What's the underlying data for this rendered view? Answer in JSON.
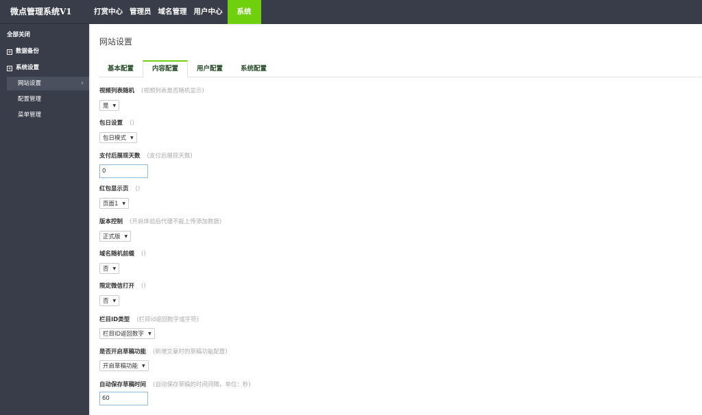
{
  "app": {
    "title": "微点管理系统V1"
  },
  "topnav": {
    "items": [
      "打赏中心",
      "管理员",
      "域名管理",
      "用户中心",
      "系统"
    ]
  },
  "sidebar": {
    "collapse_all": "全部关闭",
    "groups": [
      {
        "label": "数据备份"
      },
      {
        "label": "系统设置"
      }
    ],
    "sub_items": [
      {
        "label": "网站设置"
      },
      {
        "label": "配置管理"
      },
      {
        "label": "菜单管理"
      }
    ]
  },
  "main": {
    "title": "网站设置",
    "tabs": [
      "基本配置",
      "内容配置",
      "用户配置",
      "系统配置"
    ],
    "active_tab": "内容配置",
    "fields": [
      {
        "label": "视频列表随机",
        "hint": "(视频列表是否随机显示)",
        "value": "是"
      },
      {
        "label": "包日设置",
        "hint": "()",
        "value": "包日模式"
      },
      {
        "label": "支付后展现天数",
        "hint": "(支付后展现天数)",
        "value": "0"
      },
      {
        "label": "红包显示页",
        "hint": "()",
        "value": "页面1"
      },
      {
        "label": "版本控制",
        "hint": "(开启体验后代理不能上传添加数据)",
        "value": "正式版"
      },
      {
        "label": "域名随机前缀",
        "hint": "()",
        "value": "否"
      },
      {
        "label": "限定微信打开",
        "hint": "()",
        "value": "否"
      },
      {
        "label": "栏目ID类型",
        "hint": "(栏目id返回数字或字符)",
        "value": "栏目ID返回数字"
      },
      {
        "label": "是否开启草稿功能",
        "hint": "(新增文章时的草稿功能配置)",
        "value": "开启草稿功能"
      },
      {
        "label": "自动保存草稿时间",
        "hint": "(自动保存草稿的时间间隔，单位：秒)",
        "value": "60"
      }
    ]
  },
  "colors": {
    "accent": "#6fd00d",
    "sidebar_bg": "#393d49"
  }
}
